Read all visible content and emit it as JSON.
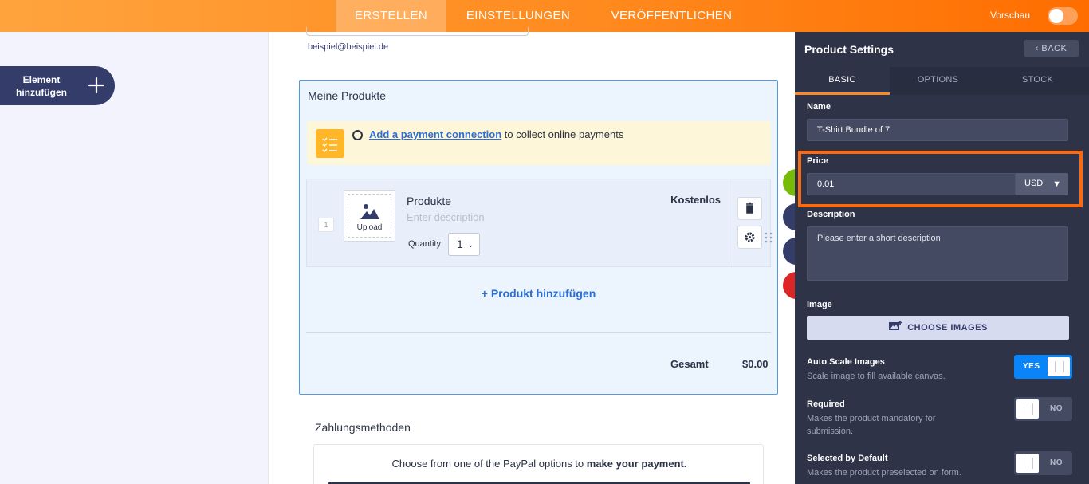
{
  "topbar": {
    "tabs": [
      "ERSTELLEN",
      "EINSTELLUNGEN",
      "VERÖFFENTLICHEN"
    ],
    "active_tab": "ERSTELLEN",
    "preview_label": "Vorschau",
    "preview_enabled": false,
    "color_start": "#ffa43d",
    "color_end": "#ff6d00"
  },
  "sidebar": {
    "add_element_label": "Element hinzufügen"
  },
  "form": {
    "email_hint": "beispiel@beispiel.de",
    "products_title": "Meine Produkte",
    "notice_link": "Add a payment connection",
    "notice_text": " to collect online payments",
    "product": {
      "number": "1",
      "upload_label": "Upload",
      "name": "Produkte",
      "description_placeholder": "Enter description",
      "quantity_label": "Quantity",
      "quantity_value": "1",
      "price": "Kostenlos"
    },
    "add_product_label": "+ Produkt hinzufügen",
    "total_label": "Gesamt",
    "total_value": "$0.00",
    "payment_title": "Zahlungsmethoden",
    "payment_text_pre": "Choose from one of the PayPal options to ",
    "payment_text_bold": "make your payment."
  },
  "settings": {
    "title": "Product Settings",
    "back_label": "BACK",
    "tabs": [
      "BASIC",
      "OPTIONS",
      "STOCK"
    ],
    "active_tab": "BASIC",
    "name_label": "Name",
    "name_value": "T-Shirt Bundle of 7",
    "price_label": "Price",
    "price_value": "0.01",
    "currency": "USD",
    "description_label": "Description",
    "description_placeholder": "Please enter a short description",
    "image_label": "Image",
    "choose_images_label": "CHOOSE IMAGES",
    "auto_scale": {
      "title": "Auto Scale Images",
      "desc": "Scale image to fill available canvas.",
      "state": "YES"
    },
    "required": {
      "title": "Required",
      "desc": "Makes the product mandatory for submission.",
      "state": "NO"
    },
    "selected_default": {
      "title": "Selected by Default",
      "desc": "Makes the product preselected on form.",
      "state": "NO"
    },
    "highlight_color": "#f86b14"
  }
}
